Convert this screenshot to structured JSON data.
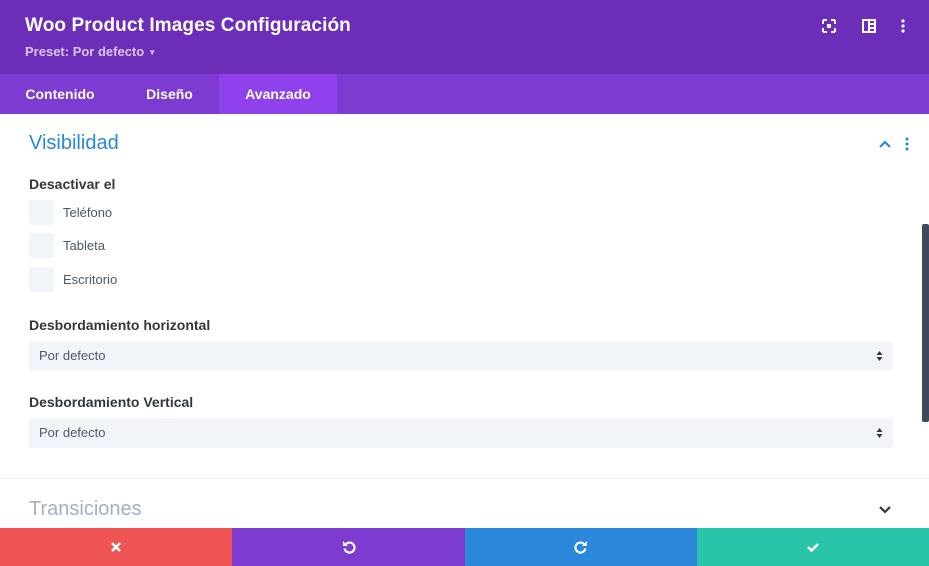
{
  "header": {
    "title": "Woo Product Images Configuración",
    "preset_label": "Preset: Por defecto",
    "background": "#6c2eb9",
    "icons": [
      "fullscreen-icon",
      "split-view-icon",
      "more-options-icon"
    ]
  },
  "tabs": {
    "items": [
      {
        "label": "Contenido",
        "active": false
      },
      {
        "label": "Diseño",
        "active": false
      },
      {
        "label": "Avanzado",
        "active": true
      }
    ],
    "background": "#7d3bd1",
    "active_background": "#8f42ec"
  },
  "visibility": {
    "title": "Visibilidad",
    "expanded": true,
    "title_color": "#2b87da",
    "disable_label": "Desactivar el",
    "options": [
      {
        "label": "Teléfono",
        "checked": false
      },
      {
        "label": "Tableta",
        "checked": false
      },
      {
        "label": "Escritorio",
        "checked": false
      }
    ],
    "overflow_x": {
      "label": "Desbordamiento horizontal",
      "value": "Por defecto"
    },
    "overflow_y": {
      "label": "Desbordamiento Vertical",
      "value": "Por defecto"
    }
  },
  "transitions": {
    "title": "Transiciones",
    "expanded": false,
    "title_color": "#a3b0c2"
  },
  "footer": {
    "buttons": [
      {
        "name": "cancel",
        "icon": "close-icon",
        "color": "#ef5555"
      },
      {
        "name": "undo",
        "icon": "undo-icon",
        "color": "#7e3bd0"
      },
      {
        "name": "redo",
        "icon": "redo-icon",
        "color": "#2b87da"
      },
      {
        "name": "save",
        "icon": "check-icon",
        "color": "#29c4a9"
      }
    ]
  }
}
